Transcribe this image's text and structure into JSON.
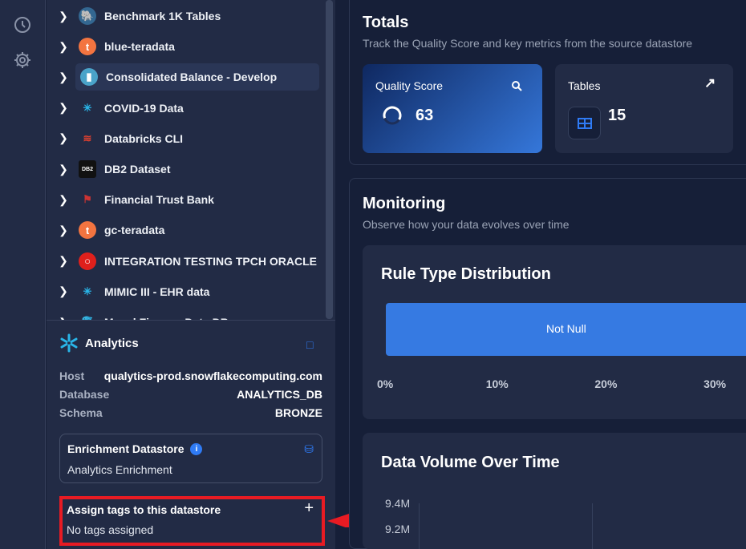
{
  "rail": {
    "icons": [
      "clock-icon",
      "gear-icon"
    ]
  },
  "tree": {
    "items": [
      {
        "label": "Benchmark 1K Tables",
        "icon": "postgresql-icon"
      },
      {
        "label": "blue-teradata",
        "icon": "teradata-icon"
      },
      {
        "label": "Consolidated Balance - Develop",
        "icon": "bucket-icon",
        "selected": true
      },
      {
        "label": "COVID-19 Data",
        "icon": "snowflake-icon"
      },
      {
        "label": "Databricks CLI",
        "icon": "databricks-icon"
      },
      {
        "label": "DB2 Dataset",
        "icon": "db2-icon"
      },
      {
        "label": "Financial Trust Bank",
        "icon": "sqlserver-icon"
      },
      {
        "label": "gc-teradata",
        "icon": "teradata-icon"
      },
      {
        "label": "INTEGRATION TESTING TPCH ORACLE",
        "icon": "oracle-icon"
      },
      {
        "label": "MIMIC III - EHR data",
        "icon": "snowflake-icon"
      },
      {
        "label": "Mysql Finance Data DB",
        "icon": "mysql-icon"
      }
    ]
  },
  "details": {
    "name": "Analytics",
    "host_label": "Host",
    "host": "qualytics-prod.snowflakecomputing.com",
    "database_label": "Database",
    "database": "ANALYTICS_DB",
    "schema_label": "Schema",
    "schema": "BRONZE",
    "enrichment": {
      "title": "Enrichment Datastore",
      "value": "Analytics Enrichment"
    },
    "tags": {
      "title": "Assign tags to this datastore",
      "value": "No tags assigned"
    }
  },
  "totals": {
    "title": "Totals",
    "subtitle": "Track the Quality Score and key metrics from the source datastore",
    "quality": {
      "label": "Quality Score",
      "value": "63"
    },
    "tables": {
      "label": "Tables",
      "value": "15"
    }
  },
  "monitoring": {
    "title": "Monitoring",
    "subtitle": "Observe how your data evolves over time"
  },
  "colors": {
    "accent": "#2f7bf5",
    "bar": "#367ae2",
    "highlight": "#e81b23"
  },
  "chart_data": [
    {
      "type": "bar",
      "title": "Rule Type Distribution",
      "orientation": "horizontal",
      "categories": [
        "Not Null"
      ],
      "values": [
        100
      ],
      "ticks": [
        "0%",
        "10%",
        "20%",
        "30%"
      ],
      "xlim": [
        0,
        100
      ]
    },
    {
      "type": "line",
      "title": "Data Volume Over Time",
      "yticks": [
        "9.4M",
        "9.2M"
      ]
    }
  ]
}
